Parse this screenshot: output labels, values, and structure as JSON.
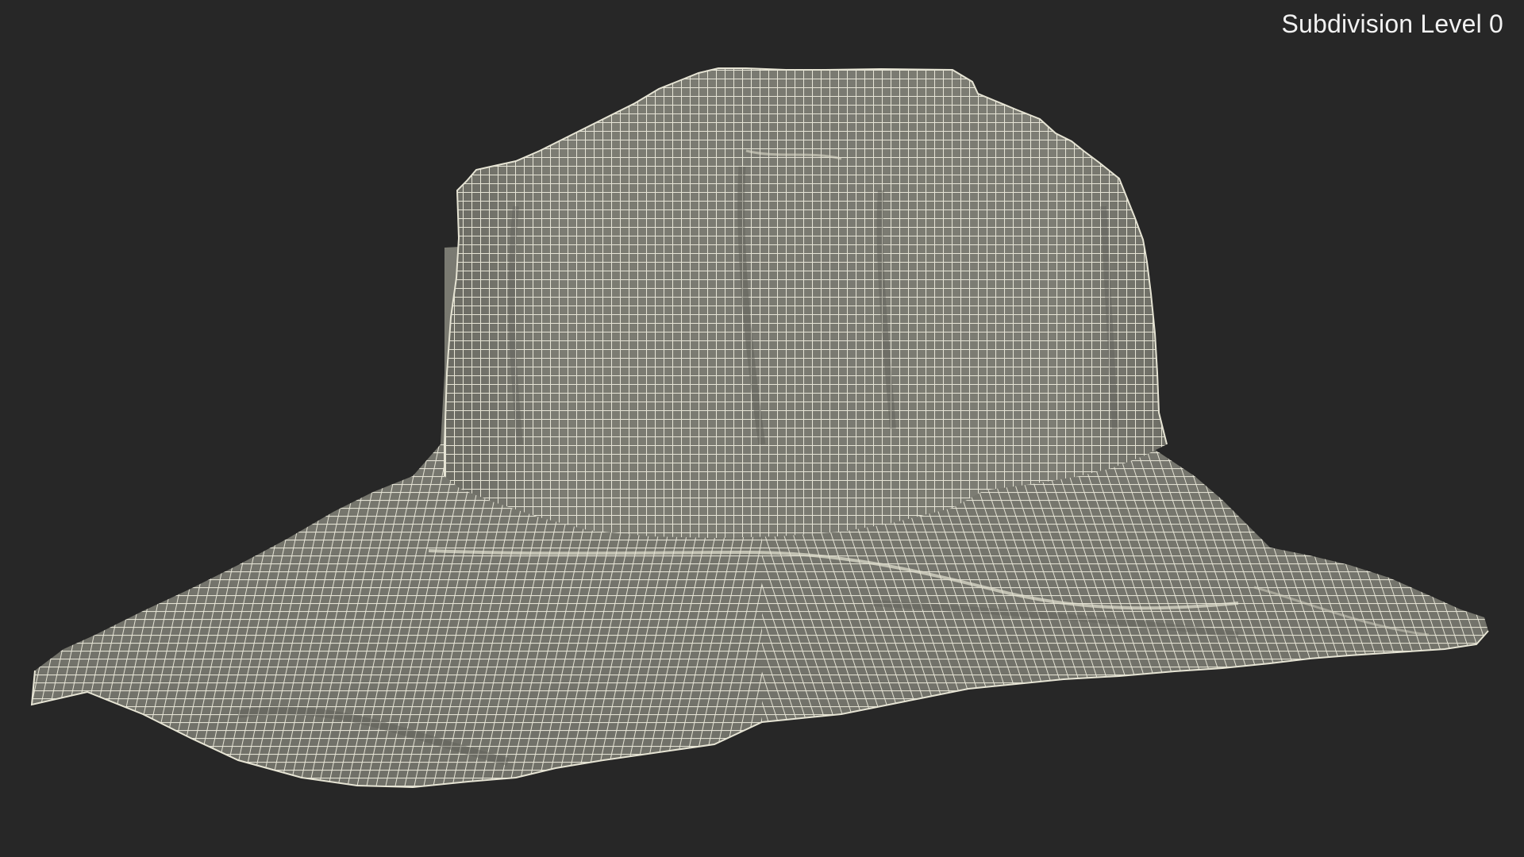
{
  "viewport": {
    "label": "Subdivision Level 0",
    "background_color": "#272727"
  },
  "model": {
    "object": "wide-brim hat",
    "display": "wireframe over shaded",
    "surface_color": "#76766d",
    "wire_color": "#eceadb"
  }
}
